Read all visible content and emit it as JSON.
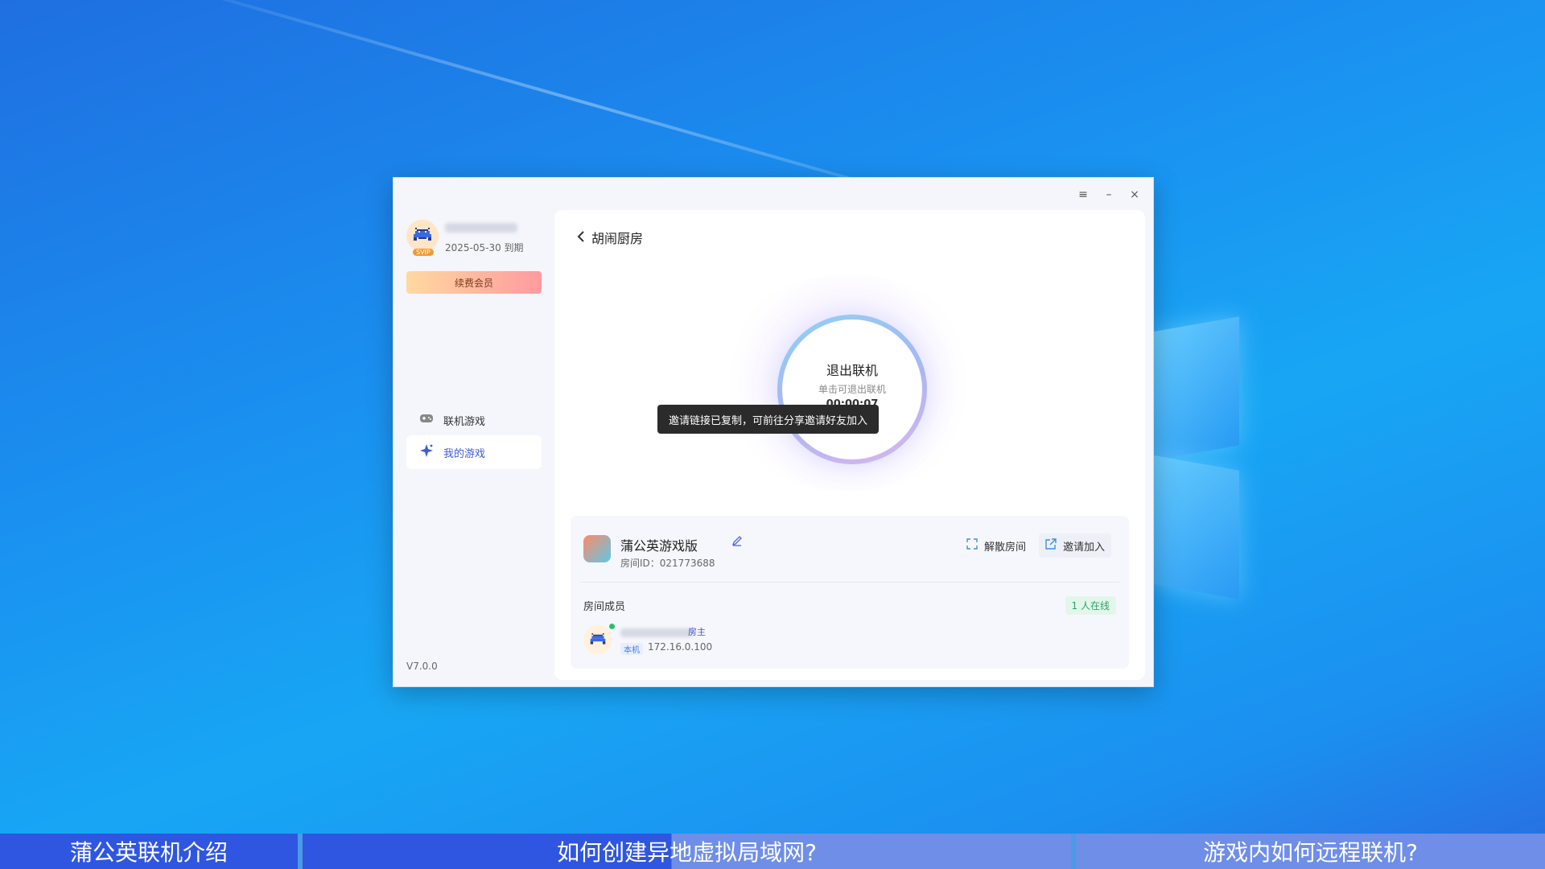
{
  "app": {
    "window_controls": {
      "menu": "≡",
      "minimize": "–",
      "close": "×"
    },
    "version": "V7.0.0"
  },
  "sidebar": {
    "expire_text": "2025-05-30 到期",
    "svip_badge": "SVIP",
    "renew_label": "续费会员",
    "nav": [
      {
        "label": "联机游戏",
        "icon": "gamepad-icon"
      },
      {
        "label": "我的游戏",
        "icon": "sparkle-icon",
        "active": true
      }
    ]
  },
  "main": {
    "back_title": "胡闹厨房",
    "exit": {
      "title": "退出联机",
      "subtitle": "单击可退出联机",
      "timer": "00:00:07"
    },
    "toast": "邀请链接已复制，可前往分享邀请好友加入",
    "room": {
      "game_name": "蒲公英游戏版",
      "room_id": "房间ID：021773688",
      "dissolve_label": "解散房间",
      "invite_label": "邀请加入",
      "members_label": "房间成员",
      "online_count": "1 人在线",
      "members": [
        {
          "host_tag": "房主",
          "local_tag": "本机",
          "ip": "172.16.0.100"
        }
      ]
    }
  },
  "bottom_bar": {
    "segments": [
      "蒲公英联机介绍",
      "如何创建异地虚拟局域网?",
      "游戏内如何远程联机?"
    ]
  }
}
